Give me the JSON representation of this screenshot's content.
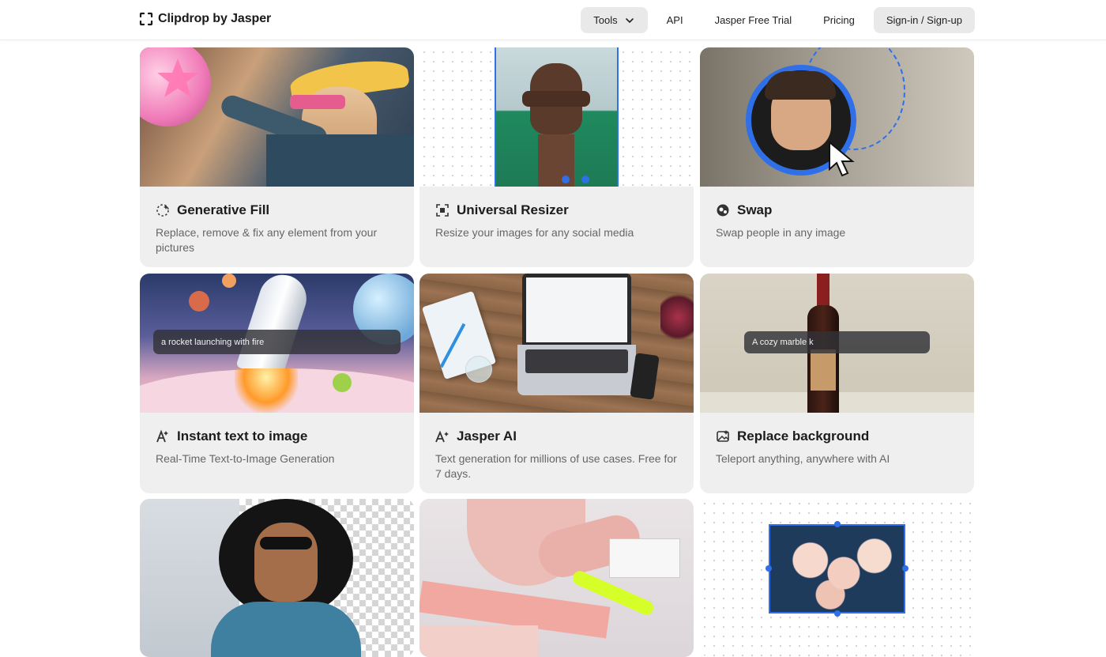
{
  "header": {
    "brand": "Clipdrop by Jasper",
    "nav": [
      {
        "label": "Tools"
      },
      {
        "label": "API"
      },
      {
        "label": "Jasper Free Trial"
      },
      {
        "label": "Pricing"
      },
      {
        "label": "Sign-in / Sign-up"
      }
    ]
  },
  "cards": [
    {
      "title": "Generative Fill",
      "desc": "Replace, remove & fix any element from your pictures",
      "icon": "sparkle-circle-icon"
    },
    {
      "title": "Universal Resizer",
      "desc": "Resize your images for any social media",
      "icon": "resize-icon"
    },
    {
      "title": "Swap",
      "desc": "Swap people in any image",
      "icon": "swap-faces-icon"
    },
    {
      "title": "Instant text to image",
      "desc": "Real-Time Text-to-Image Generation",
      "icon": "text-to-image-icon"
    },
    {
      "title": "Jasper AI",
      "desc": "Text generation for millions of use cases. Free for 7 days.",
      "icon": "jasper-ai-icon"
    },
    {
      "title": "Replace background",
      "desc": "Teleport anything, anywhere with AI",
      "icon": "replace-background-icon"
    },
    {
      "title": "",
      "desc": "",
      "icon": ""
    },
    {
      "title": "",
      "desc": "",
      "icon": ""
    },
    {
      "title": "",
      "desc": "",
      "icon": ""
    }
  ],
  "prompts": {
    "rocket": "a rocket launching with fire",
    "wine": "A cozy marble k"
  },
  "colors": {
    "accent_blue": "#2f6fe8",
    "card_bg": "#efefef"
  }
}
